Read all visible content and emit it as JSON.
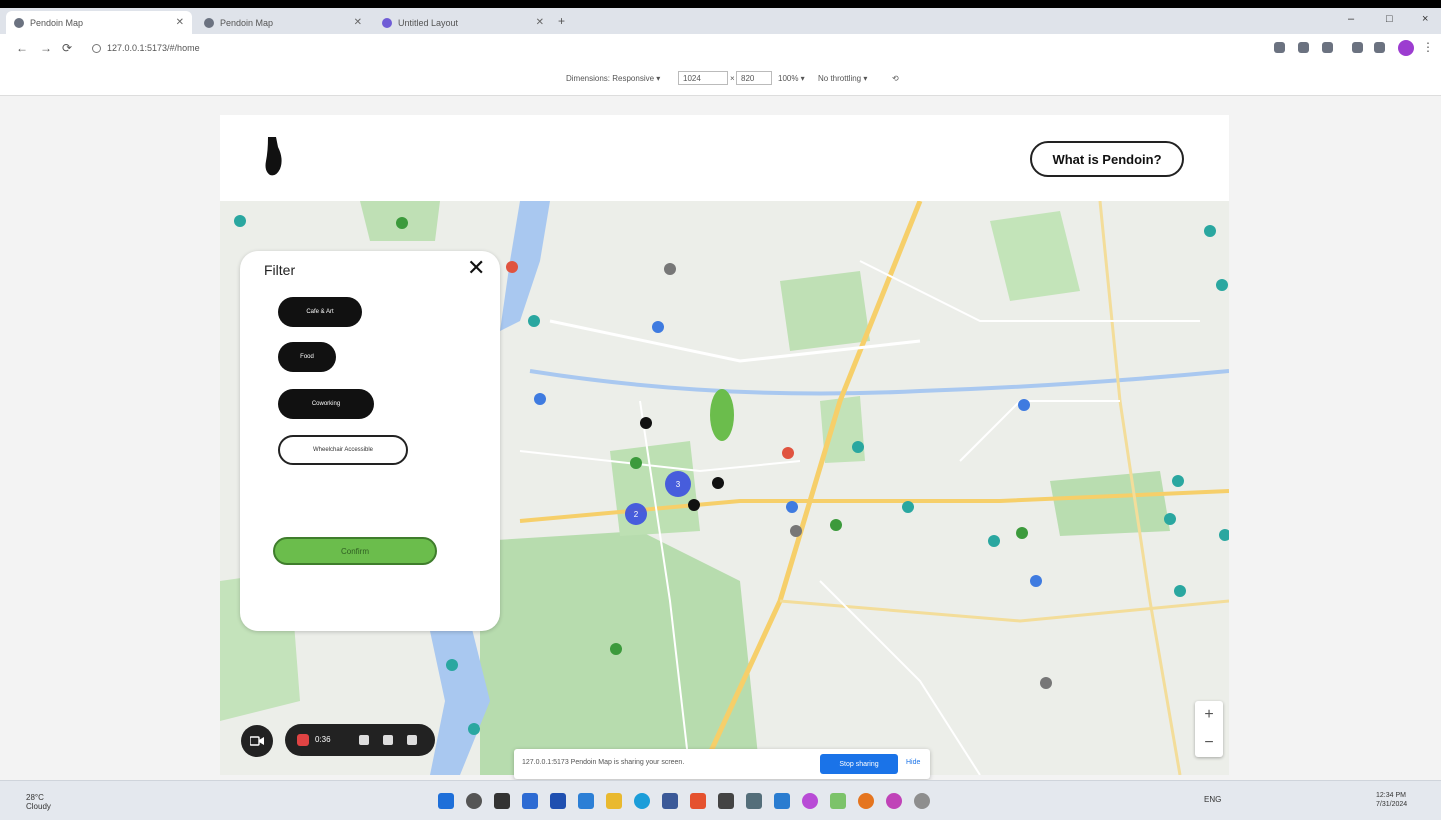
{
  "browser": {
    "tabs": [
      {
        "label": "Pendoin Map"
      },
      {
        "label": "Pendoin Map"
      },
      {
        "label": "Untitled Layout"
      }
    ],
    "new_tab_label": "+",
    "url": "127.0.0.1:5173/#/home",
    "window_controls": [
      "–",
      "□",
      "×"
    ],
    "nav": {
      "back": "←",
      "forward": "→",
      "reload": "⟳"
    },
    "devtools": {
      "device": "Dimensions: Responsive ▾",
      "width": "1024",
      "height": "820",
      "zoom": "100% ▾",
      "throttle": "No throttling ▾"
    }
  },
  "site": {
    "what_label": "What is Pendoin?"
  },
  "filter": {
    "title": "Filter",
    "close_glyph": "✕",
    "options": [
      {
        "label": "Cafe & Art",
        "active": true
      },
      {
        "label": "Food",
        "active": true
      },
      {
        "label": "Coworking",
        "active": true
      },
      {
        "label": "Wheelchair Accessible",
        "active": false
      }
    ],
    "confirm_label": "Confirm"
  },
  "map": {
    "zoom_in": "+",
    "zoom_out": "−",
    "colors": {
      "park": "#b7dcae",
      "water": "#a9c8f0",
      "road": "#f6cf6a",
      "pin_teal": "#2aa7a0",
      "pin_blue": "#3f7be0",
      "pin_green": "#3c9a3c"
    },
    "clusters": [
      {
        "label": "3"
      },
      {
        "label": "2"
      }
    ]
  },
  "recorder": {
    "time": "0:36"
  },
  "share": {
    "text": "127.0.0.1:5173 Pendoin Map is sharing your screen.",
    "share_label": "Stop sharing",
    "hide_label": "Hide"
  },
  "taskbar": {
    "weather_temp": "28°C",
    "weather_desc": "Cloudy",
    "tray": "ENG",
    "time": "12:34 PM",
    "date": "7/31/2024"
  }
}
